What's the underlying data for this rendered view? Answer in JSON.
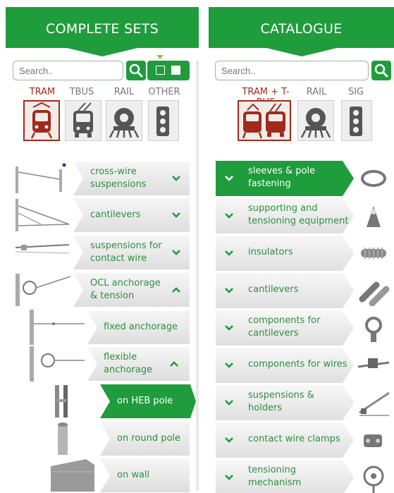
{
  "colors": {
    "brand_green": "#1f9c3c",
    "accent_red": "#a12a1c",
    "text_green": "#2e8f3e"
  },
  "left": {
    "header": {
      "title": "COMPLETE SETS"
    },
    "search": {
      "placeholder": "Search.."
    },
    "categories": [
      {
        "label": "TRAM",
        "icon": "tram-icon",
        "active": true
      },
      {
        "label": "TBUS",
        "icon": "trolleybus-icon",
        "active": false
      },
      {
        "label": "RAIL",
        "icon": "locomotive-icon",
        "active": false
      },
      {
        "label": "OTHER",
        "icon": "traffic-light-icon",
        "active": false
      }
    ],
    "items": [
      {
        "label_lines": [
          "cross-wire",
          "suspensions"
        ],
        "expanded": false
      },
      {
        "label_lines": [
          "cantilevers"
        ],
        "expanded": false
      },
      {
        "label_lines": [
          "suspensions for",
          "contact wire"
        ],
        "expanded": false
      },
      {
        "label_lines": [
          "OCL anchorage",
          "& tension"
        ],
        "expanded": true
      },
      {
        "label_lines": [
          "fixed anchorage"
        ]
      },
      {
        "label_lines": [
          "flexible",
          "anchorage"
        ],
        "expanded": true
      },
      {
        "label_lines": [
          "on HEB pole"
        ],
        "selected": true
      },
      {
        "label_lines": [
          "on round pole"
        ]
      },
      {
        "label_lines": [
          "on wall"
        ]
      }
    ]
  },
  "right": {
    "header": {
      "title": "CATALOGUE"
    },
    "search": {
      "placeholder": "Search.."
    },
    "categories": [
      {
        "label": "TRAM + T-BUS",
        "icon": "tram-trolleybus-icon",
        "active": true
      },
      {
        "label": "RAIL",
        "icon": "locomotive-icon",
        "active": false
      },
      {
        "label": "SIG",
        "icon": "traffic-light-icon",
        "active": false
      }
    ],
    "items": [
      {
        "label_lines": [
          "sleeves & pole",
          "fastening"
        ],
        "active": true
      },
      {
        "label_lines": [
          "supporting and",
          "tensioning equipment"
        ]
      },
      {
        "label_lines": [
          "insulators"
        ]
      },
      {
        "label_lines": [
          "cantilevers"
        ]
      },
      {
        "label_lines": [
          "components for",
          "cantilevers"
        ]
      },
      {
        "label_lines": [
          "components for wires"
        ]
      },
      {
        "label_lines": [
          "suspensions &",
          "holders"
        ]
      },
      {
        "label_lines": [
          "contact wire clamps"
        ]
      },
      {
        "label_lines": [
          "tensioning",
          "mechanism"
        ]
      }
    ]
  }
}
